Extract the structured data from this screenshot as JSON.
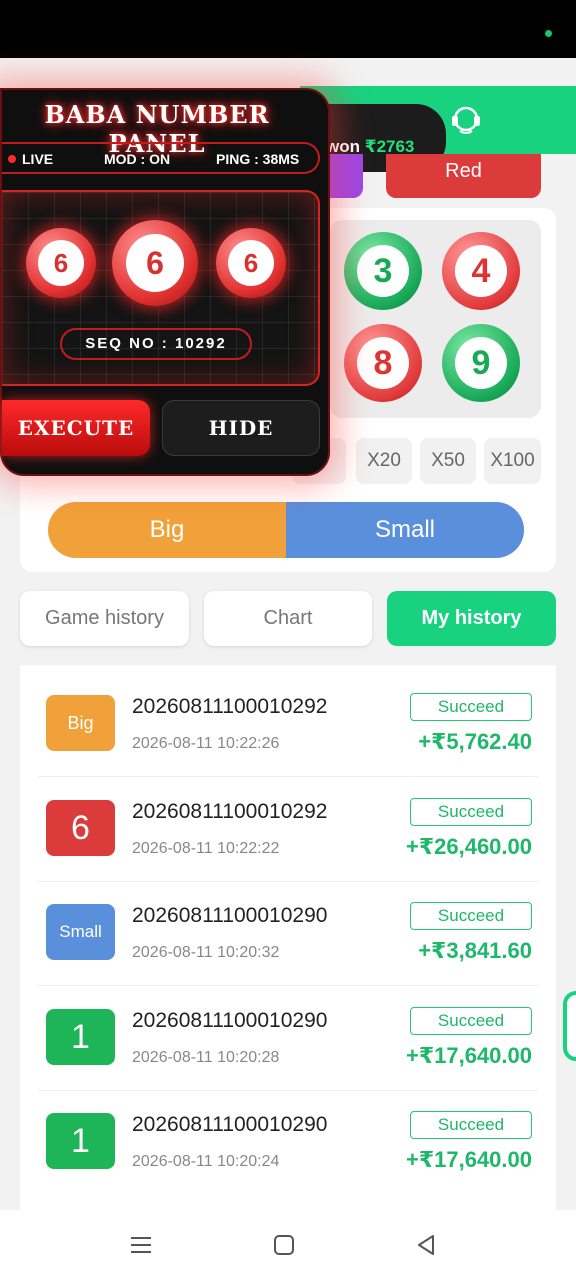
{
  "header": {
    "win_prefix": "won",
    "win_amount": "₹2763"
  },
  "color_options": {
    "red_label": "Red"
  },
  "numbers": [
    {
      "value": "3",
      "color": "green"
    },
    {
      "value": "4",
      "color": "red"
    },
    {
      "value": "8",
      "color": "red"
    },
    {
      "value": "9",
      "color": "green"
    }
  ],
  "multipliers": [
    "0",
    "X20",
    "X50",
    "X100"
  ],
  "big_small": {
    "big_label": "Big",
    "small_label": "Small"
  },
  "tabs": [
    {
      "label": "Game history",
      "active": false
    },
    {
      "label": "Chart",
      "active": false
    },
    {
      "label": "My history",
      "active": true
    }
  ],
  "history": [
    {
      "result": "Big",
      "type": "big",
      "period": "20260811100010292",
      "time": "2026-08-11 10:22:26",
      "status": "Succeed",
      "amount": "+₹5,762.40"
    },
    {
      "result": "6",
      "type": "red",
      "period": "20260811100010292",
      "time": "2026-08-11 10:22:22",
      "status": "Succeed",
      "amount": "+₹26,460.00"
    },
    {
      "result": "Small",
      "type": "small",
      "period": "20260811100010290",
      "time": "2026-08-11 10:20:32",
      "status": "Succeed",
      "amount": "+₹3,841.60"
    },
    {
      "result": "1",
      "type": "green",
      "period": "20260811100010290",
      "time": "2026-08-11 10:20:28",
      "status": "Succeed",
      "amount": "+₹17,640.00"
    },
    {
      "result": "1",
      "type": "green",
      "period": "20260811100010290",
      "time": "2026-08-11 10:20:24",
      "status": "Succeed",
      "amount": "+₹17,640.00"
    }
  ],
  "panel": {
    "title": "BABA NUMBER PANEL",
    "live": "LIVE",
    "mod": "MOD : ON",
    "ping": "PING : 38MS",
    "balls": [
      "6",
      "6",
      "6"
    ],
    "seq": "SEQ NO : 10292",
    "execute_label": "EXECUTE",
    "hide_label": "HIDE"
  },
  "colors": {
    "accent": "#18d280",
    "red": "#dc3b3b",
    "orange": "#f1a13a",
    "blue": "#5a8fdc",
    "green": "#1db557"
  }
}
